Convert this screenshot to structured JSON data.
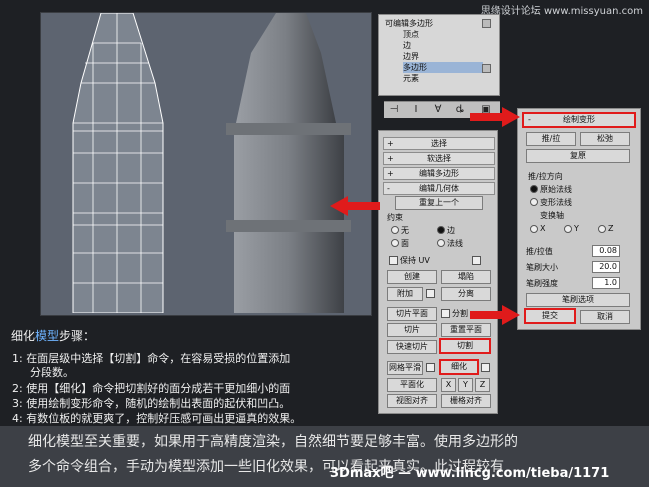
{
  "watermark_top": "思缘设计论坛 www.missyuan.com",
  "modifier_stack": {
    "items": [
      "可编辑多边形",
      "顶点",
      "边",
      "边界",
      "多边形",
      "元素"
    ],
    "selected_index": 4
  },
  "command_panel": {
    "rollouts": [
      "选择",
      "软选择",
      "编辑多边形",
      "编辑几何体"
    ],
    "repeat_last": "重复上一个",
    "constraints_label": "约束",
    "constraints": [
      "无",
      "边",
      "面",
      "法线"
    ],
    "preserve_uv": "保持 UV",
    "create": "创建",
    "collapse": "塌陷",
    "attach": "附加",
    "detach": "分离",
    "slice_plane": "切片平面",
    "split": "分割",
    "slice": "切片",
    "reset_plane": "重置平面",
    "quickslice": "快速切片",
    "cut": "切割",
    "meshsmooth": "网格平滑",
    "tessellate": "细化",
    "make_planar": "平面化",
    "x": "X",
    "y": "Y",
    "z": "Z",
    "view_align": "视图对齐",
    "grid_align": "栅格对齐"
  },
  "paint_panel": {
    "title": "绘制变形",
    "push_pull": "推/拉",
    "relax": "松弛",
    "revert": "复原",
    "direction_label": "推/拉方向",
    "directions": [
      "原始法线",
      "变形法线",
      "变换轴"
    ],
    "axes": [
      "X",
      "Y",
      "Z"
    ],
    "push_value_label": "推/拉值",
    "push_value": "0.08",
    "brush_size_label": "笔刷大小",
    "brush_size": "20.0",
    "brush_strength_label": "笔刷强度",
    "brush_strength": "1.0",
    "brush_options": "笔刷选项",
    "commit": "提交",
    "cancel": "取消"
  },
  "steps": {
    "title_prefix": "细化",
    "title_highlight": "模型",
    "title_suffix": "步骤：",
    "items": [
      "1: 在面层级中选择【切割】命令，在容易受损的位置添加",
      "    分段数。",
      "2: 使用【细化】命令把切割好的面分成若干更加细小的面",
      "3: 使用绘制变形命令，随机的绘制出表面的起伏和凹凸。",
      "4: 有数位板的就更爽了，控制好压感可画出更逼真的效果。"
    ]
  },
  "paragraph": [
    "细化模型至关重要，如果用于高精度渲染，自然细节要足够丰富。使用多边形的",
    "多个命令组合，手动为模型添加一些旧化效果，可以看起来真实。此过程较有"
  ],
  "watermark_bottom": "3Dmax吧 — www.lincg.com/tieba/1171"
}
